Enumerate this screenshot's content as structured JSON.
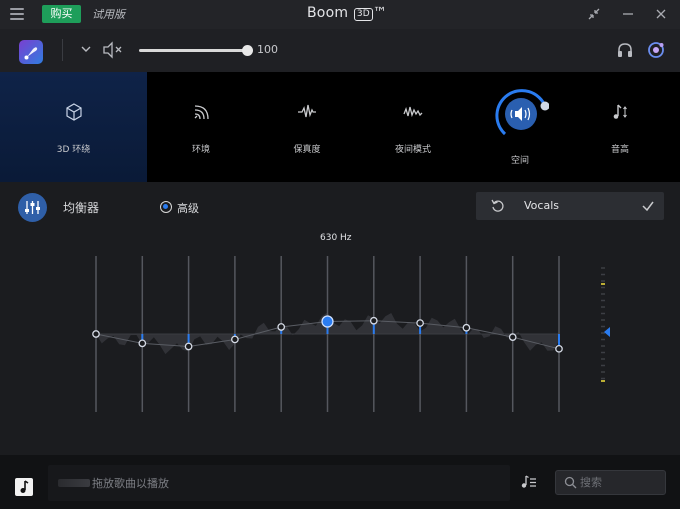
{
  "titlebar": {
    "buy_label": "购买",
    "trial_label": "试用版",
    "app_name": "Boom",
    "app_badge": "3D",
    "trademark": "™"
  },
  "volume": {
    "value": "100",
    "level_fraction": 1.0
  },
  "effects": [
    {
      "label": "3D 环绕",
      "icon": "cube-icon",
      "active": true
    },
    {
      "label": "环境",
      "icon": "ambience-icon",
      "active": false
    },
    {
      "label": "保真度",
      "icon": "fidelity-wave-icon",
      "active": false
    },
    {
      "label": "夜间模式",
      "icon": "night-wave-icon",
      "active": false
    },
    {
      "label": "空间",
      "icon": "spatial-speaker-icon",
      "active": false
    },
    {
      "label": "音高",
      "icon": "pitch-note-icon",
      "active": false
    }
  ],
  "equalizer": {
    "label": "均衡器",
    "advanced_label": "高级",
    "preset_name": "Vocals",
    "selected_band_label": "630 Hz",
    "band_levels": [
      0.0,
      -0.12,
      -0.16,
      -0.07,
      0.09,
      0.16,
      0.17,
      0.14,
      0.08,
      -0.04,
      -0.19
    ],
    "selected_band_index": 5
  },
  "footer": {
    "drop_text": "拖放歌曲以播放",
    "search_placeholder": "搜索"
  },
  "colors": {
    "accent": "#2a7cf0",
    "buy_green": "#1e9e5a",
    "active_effect_bg": "#0f2348",
    "level_yellow": "#e5d23a"
  }
}
